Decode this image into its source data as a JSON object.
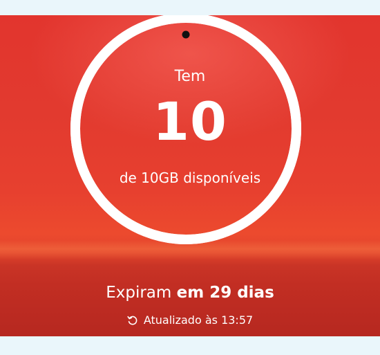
{
  "usage": {
    "prefix": "Tem",
    "amount": "10",
    "total_text": "de 10GB disponíveis",
    "remaining_fraction": 1.0
  },
  "expiry": {
    "text_regular": "Expiram ",
    "text_bold": "em 29 dias"
  },
  "updated": {
    "icon": "refresh-icon",
    "text": "Atualizado às 13:57"
  },
  "colors": {
    "brand_red": "#e2352e",
    "ring": "#f4f4f4",
    "text": "#ffffff"
  }
}
